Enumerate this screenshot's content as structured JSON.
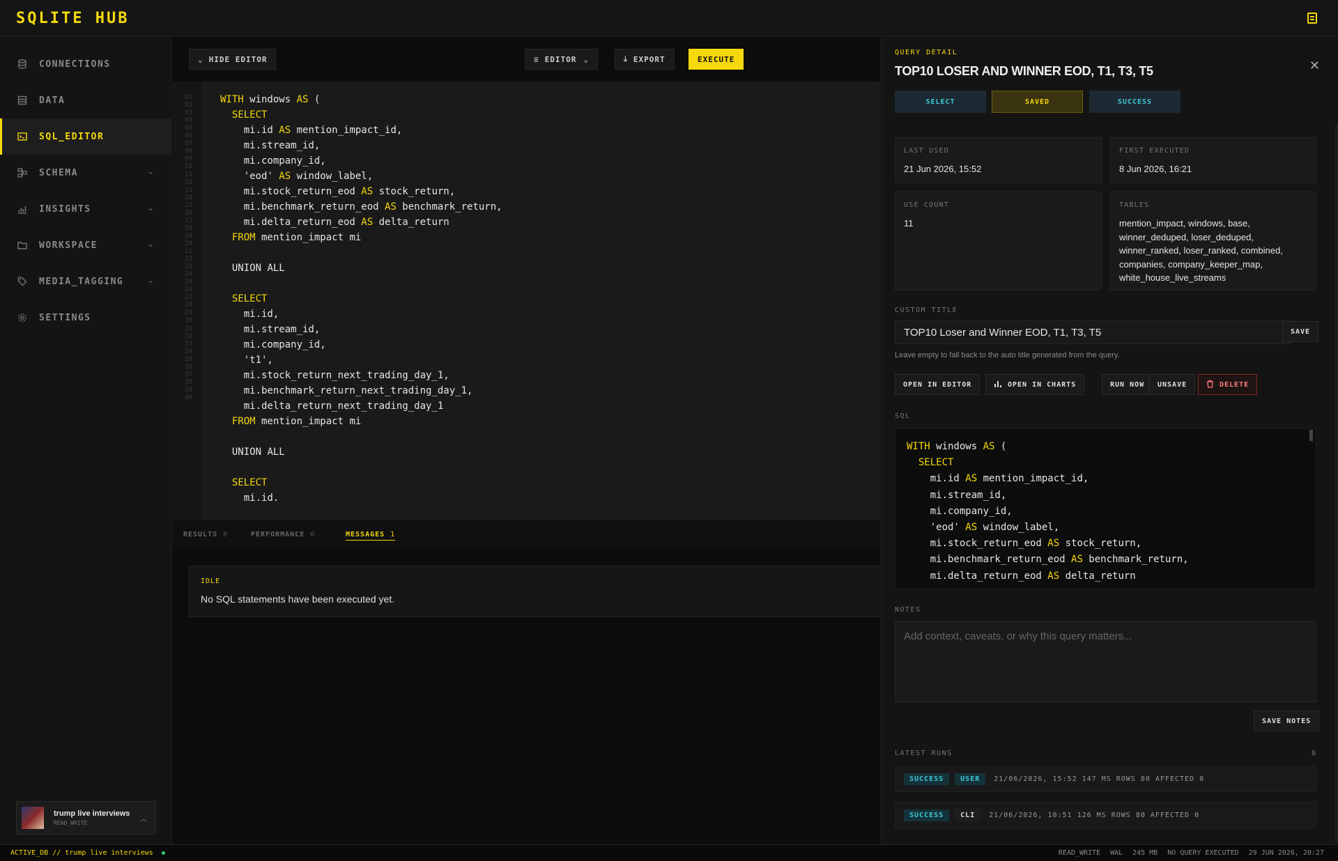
{
  "app": {
    "title": "SQLITE HUB"
  },
  "sidebar": {
    "items": [
      {
        "label": "CONNECTIONS",
        "icon": "database-icon",
        "active": false,
        "has_chevron": false
      },
      {
        "label": "DATA",
        "icon": "table-icon",
        "active": false,
        "has_chevron": false
      },
      {
        "label": "SQL_EDITOR",
        "icon": "terminal-icon",
        "active": true,
        "has_chevron": false
      },
      {
        "label": "SCHEMA",
        "icon": "schema-icon",
        "active": false,
        "has_chevron": true
      },
      {
        "label": "INSIGHTS",
        "icon": "chart-icon",
        "active": false,
        "has_chevron": true
      },
      {
        "label": "WORKSPACE",
        "icon": "folder-icon",
        "active": false,
        "has_chevron": true
      },
      {
        "label": "MEDIA_TAGGING",
        "icon": "tag-icon",
        "active": false,
        "has_chevron": true
      },
      {
        "label": "SETTINGS",
        "icon": "gear-icon",
        "active": false,
        "has_chevron": false
      }
    ],
    "db_card": {
      "name": "trump live interviews",
      "mode": "READ_WRITE"
    }
  },
  "toolbar": {
    "hide_editor": "HIDE EDITOR",
    "editor": "EDITOR",
    "export": "EXPORT",
    "execute": "EXECUTE"
  },
  "editor": {
    "line_numbers": [
      "01",
      "02",
      "03",
      "04",
      "05",
      "06",
      "07",
      "08",
      "09",
      "10",
      "11",
      "12",
      "13",
      "14",
      "15",
      "16",
      "17",
      "18",
      "19",
      "20",
      "21",
      "22",
      "23",
      "24",
      "25",
      "26",
      "27",
      "28",
      "29",
      "30",
      "31",
      "32",
      "33",
      "34",
      "35",
      "36",
      "37",
      "38",
      "39",
      "40"
    ],
    "lines": [
      "",
      "WITH windows AS (",
      "  SELECT",
      "    mi.id AS mention_impact_id,",
      "    mi.stream_id,",
      "    mi.company_id,",
      "    'eod' AS window_label,",
      "    mi.stock_return_eod AS stock_return,",
      "    mi.benchmark_return_eod AS benchmark_return,",
      "    mi.delta_return_eod AS delta_return",
      "  FROM mention_impact mi",
      "",
      "  UNION ALL",
      "",
      "  SELECT",
      "    mi.id,",
      "    mi.stream_id,",
      "    mi.company_id,",
      "    't1',",
      "    mi.stock_return_next_trading_day_1,",
      "    mi.benchmark_return_next_trading_day_1,",
      "    mi.delta_return_next_trading_day_1",
      "  FROM mention_impact mi",
      "",
      "  UNION ALL",
      "",
      "  SELECT",
      "    mi.id."
    ]
  },
  "results": {
    "tabs": [
      {
        "label": "RESULTS",
        "count": "0",
        "active": false
      },
      {
        "label": "PERFORMANCE",
        "count": "0",
        "active": false
      },
      {
        "label": "MESSAGES",
        "count": "1",
        "active": true
      }
    ],
    "idle_label": "IDLE",
    "idle_message": "No SQL statements have been executed yet."
  },
  "detail": {
    "eyebrow": "QUERY DETAIL",
    "title": "TOP10 LOSER AND WINNER EOD, T1, T3, T5",
    "badges": {
      "type": "SELECT",
      "saved": "SAVED",
      "status": "SUCCESS"
    },
    "last_used_label": "LAST USED",
    "last_used": "21 Jun 2026, 15:52",
    "first_executed_label": "FIRST EXECUTED",
    "first_executed": "8 Jun 2026, 16:21",
    "use_count_label": "USE COUNT",
    "use_count": "11",
    "tables_label": "TABLES",
    "tables": "mention_impact, windows, base, winner_deduped, loser_deduped, winner_ranked, loser_ranked, combined, companies, company_keeper_map, white_house_live_streams",
    "custom_title_label": "CUSTOM TITLE",
    "custom_title_value": "TOP10 Loser and Winner EOD, T1, T3, T5",
    "save": "SAVE",
    "hint": "Leave empty to fall back to the auto title generated from the query.",
    "actions": {
      "open_editor": "OPEN IN EDITOR",
      "open_charts": "OPEN IN CHARTS",
      "run_now": "RUN NOW",
      "unsave": "UNSAVE",
      "delete": "DELETE"
    },
    "sql_label": "SQL",
    "sql_lines": [
      "WITH windows AS (",
      "  SELECT",
      "    mi.id AS mention_impact_id,",
      "    mi.stream_id,",
      "    mi.company_id,",
      "    'eod' AS window_label,",
      "    mi.stock_return_eod AS stock_return,",
      "    mi.benchmark_return_eod AS benchmark_return,",
      "    mi.delta_return_eod AS delta_return"
    ],
    "notes_label": "NOTES",
    "notes_placeholder": "Add context, caveats, or why this query matters...",
    "save_notes": "SAVE NOTES",
    "latest_runs_label": "LATEST RUNS",
    "latest_runs_count": "8",
    "runs": [
      {
        "status": "SUCCESS",
        "source": "USER",
        "text": "21/06/2026, 15:52 147 MS ROWS 80 AFFECTED 0"
      },
      {
        "status": "SUCCESS",
        "source": "CLI",
        "text": "21/06/2026, 10:51 126 MS ROWS 80 AFFECTED 0"
      }
    ]
  },
  "status": {
    "active_db": "ACTIVE_DB // trump live interviews",
    "mode": "READ_WRITE",
    "journal": "WAL",
    "size": "245 MB",
    "query_state": "NO QUERY EXECUTED",
    "datetime": "29 JUN 2026, 20:27"
  },
  "colors": {
    "accent": "#f5d90a",
    "success": "#3fc7d8",
    "danger": "#ff7a7a",
    "background": "#0c0c0c"
  }
}
